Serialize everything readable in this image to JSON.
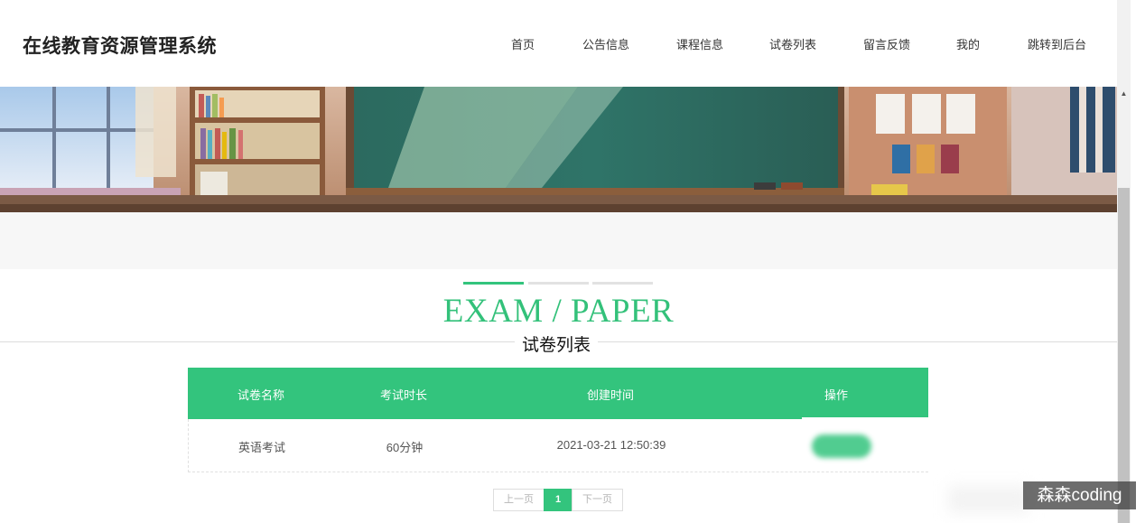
{
  "header": {
    "site_title": "在线教育资源管理系统",
    "nav": [
      {
        "label": "首页"
      },
      {
        "label": "公告信息"
      },
      {
        "label": "课程信息"
      },
      {
        "label": "试卷列表"
      },
      {
        "label": "留言反馈"
      },
      {
        "label": "我的"
      },
      {
        "label": "跳转到后台"
      }
    ]
  },
  "section": {
    "title_en": "EXAM / PAPER",
    "title_cn": "试卷列表",
    "accent_color": "#33c47d"
  },
  "table": {
    "columns": [
      "试卷名称",
      "考试时长",
      "创建时间",
      "操作"
    ],
    "rows": [
      {
        "name": "英语考试",
        "duration": "60分钟",
        "created": "2021-03-21 12:50:39"
      }
    ]
  },
  "pager": {
    "prev": "上一页",
    "current": "1",
    "next": "下一页"
  },
  "watermark": "森森coding"
}
